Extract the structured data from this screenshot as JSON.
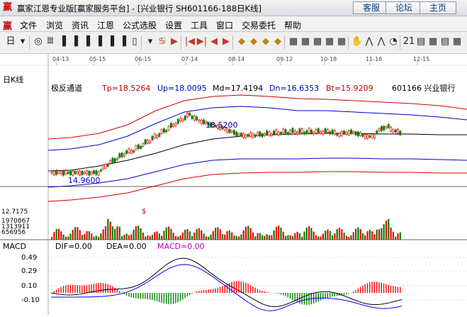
{
  "window": {
    "logo": "赢",
    "title": "赢家江恩专业版[赢家服务平台] - [兴业银行  SH601166-188日K线]",
    "buttons": [
      "客服",
      "论坛",
      "主页"
    ]
  },
  "menu": {
    "logo": "赢",
    "items": [
      "文件",
      "浏览",
      "资讯",
      "江恩",
      "公式选股",
      "设置",
      "工具",
      "窗口",
      "交易委托",
      "帮助"
    ]
  },
  "toolbar": {
    "icons": [
      "daily-chart-icon",
      "dropdown-icon",
      "wave-icon",
      "candle-icon",
      "kline1-icon",
      "kline2-icon",
      "kline3-icon",
      "kline4-icon",
      "kline5-icon",
      "kline6-icon",
      "tick-icon",
      "dropdown-icon",
      "gann-icon",
      "flag-icon",
      "first-icon",
      "last-icon",
      "prev-icon",
      "next-icon",
      "diamond1-icon",
      "diamond2-icon",
      "diamond3-icon",
      "diamond4-icon",
      "grid1-icon",
      "grid2-icon",
      "grid3-icon",
      "grid4-icon",
      "grid5-icon",
      "hand-icon",
      "trend-icon",
      "zigzag-icon",
      "pie-icon",
      "cal-icon",
      "calendar-icon",
      "calc-icon",
      "stats-icon",
      "table-icon",
      "list-icon"
    ],
    "symbols": [
      "日",
      "▾",
      "◎",
      "𝄜",
      "▐",
      "▐",
      "▐",
      "▐",
      "▐",
      "▐",
      "▯",
      "▾",
      "♋",
      "▶",
      "|◀",
      "▶|",
      "◀",
      "▶",
      "◆",
      "◆",
      "◆",
      "◆",
      "▦",
      "▦",
      "▦",
      "▦",
      "▦",
      "✋",
      "⋀",
      "⋀",
      "◔",
      "21",
      "▤",
      "▦",
      "▤",
      "▦",
      "▤"
    ]
  },
  "main_panel": {
    "period_label": "日K线",
    "date_ticks": [
      "04-13",
      "05-15",
      "06-15",
      "07-14",
      "08-14",
      "09-12",
      "10-18",
      "11-16",
      "12-15"
    ],
    "indicator_name": "极反通道",
    "tp": "Tp=18.5264",
    "up": "Up=18.0095",
    "md": "Md=17.4194",
    "dn": "Dn=16.6353",
    "bt": "Bt=15.9209",
    "stock": "601166  兴业银行",
    "annotations": {
      "high": "18.5200",
      "low": "14.9600",
      "dollar": "$"
    }
  },
  "volume_panel": {
    "labels": [
      "12.7175",
      "1970867",
      "1313911",
      "656956"
    ]
  },
  "macd_panel": {
    "name": "MACD",
    "dif": "DIF=0.00",
    "dea": "DEA=0.00",
    "macd": "MACD=0.00",
    "y_ticks": [
      "0.49",
      "0.29",
      "0.10",
      "-0.10"
    ]
  },
  "colors": {
    "up": "#ff0000",
    "down": "#008000",
    "blue": "#0000ff",
    "macd_label": "#c000c0"
  }
}
